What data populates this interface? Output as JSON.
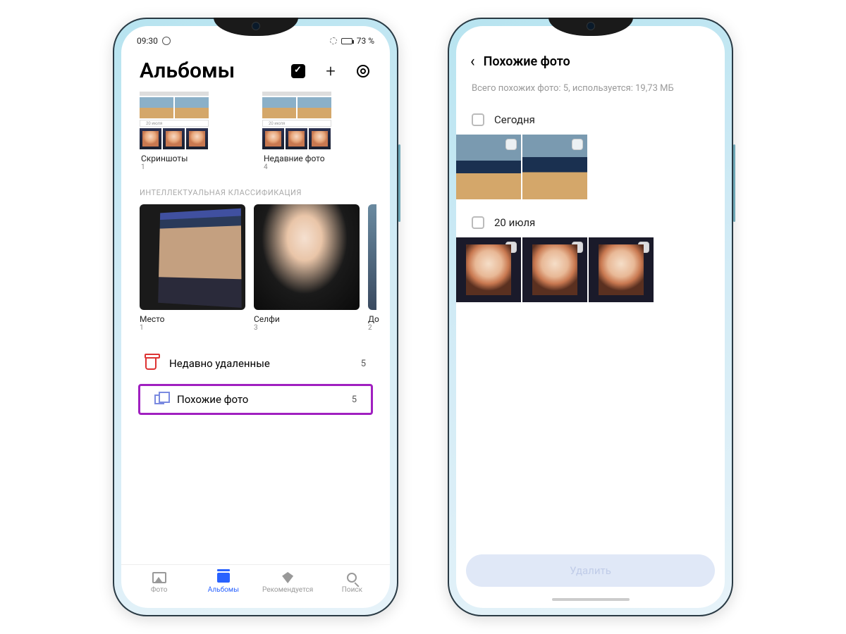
{
  "statusbar": {
    "time": "09:30",
    "battery_pct": "73 %"
  },
  "left": {
    "header_title": "Альбомы",
    "albums": [
      {
        "label": "Скриншоты",
        "count": "1",
        "inner_date": "20 июля"
      },
      {
        "label": "Недавние фото",
        "count": "4",
        "inner_date": "20 июля"
      }
    ],
    "section": "ИНТЕЛЛЕКТУАЛЬНАЯ КЛАССИФИКАЦИЯ",
    "classes": [
      {
        "label": "Место",
        "count": "1"
      },
      {
        "label": "Селфи",
        "count": "3"
      },
      {
        "label": "До",
        "count": "2"
      }
    ],
    "recent_deleted": {
      "label": "Недавно удаленные",
      "count": "5"
    },
    "similar": {
      "label": "Похожие фото",
      "count": "5"
    },
    "nav": {
      "photos": "Фото",
      "albums": "Альбомы",
      "recommended": "Рекомендуется",
      "search": "Поиск"
    }
  },
  "right": {
    "title": "Похожие фото",
    "summary": "Всего похожих фото: 5, используется: 19,73 МБ",
    "group1": "Сегодня",
    "group2": "20 июля",
    "delete_label": "Удалить"
  }
}
